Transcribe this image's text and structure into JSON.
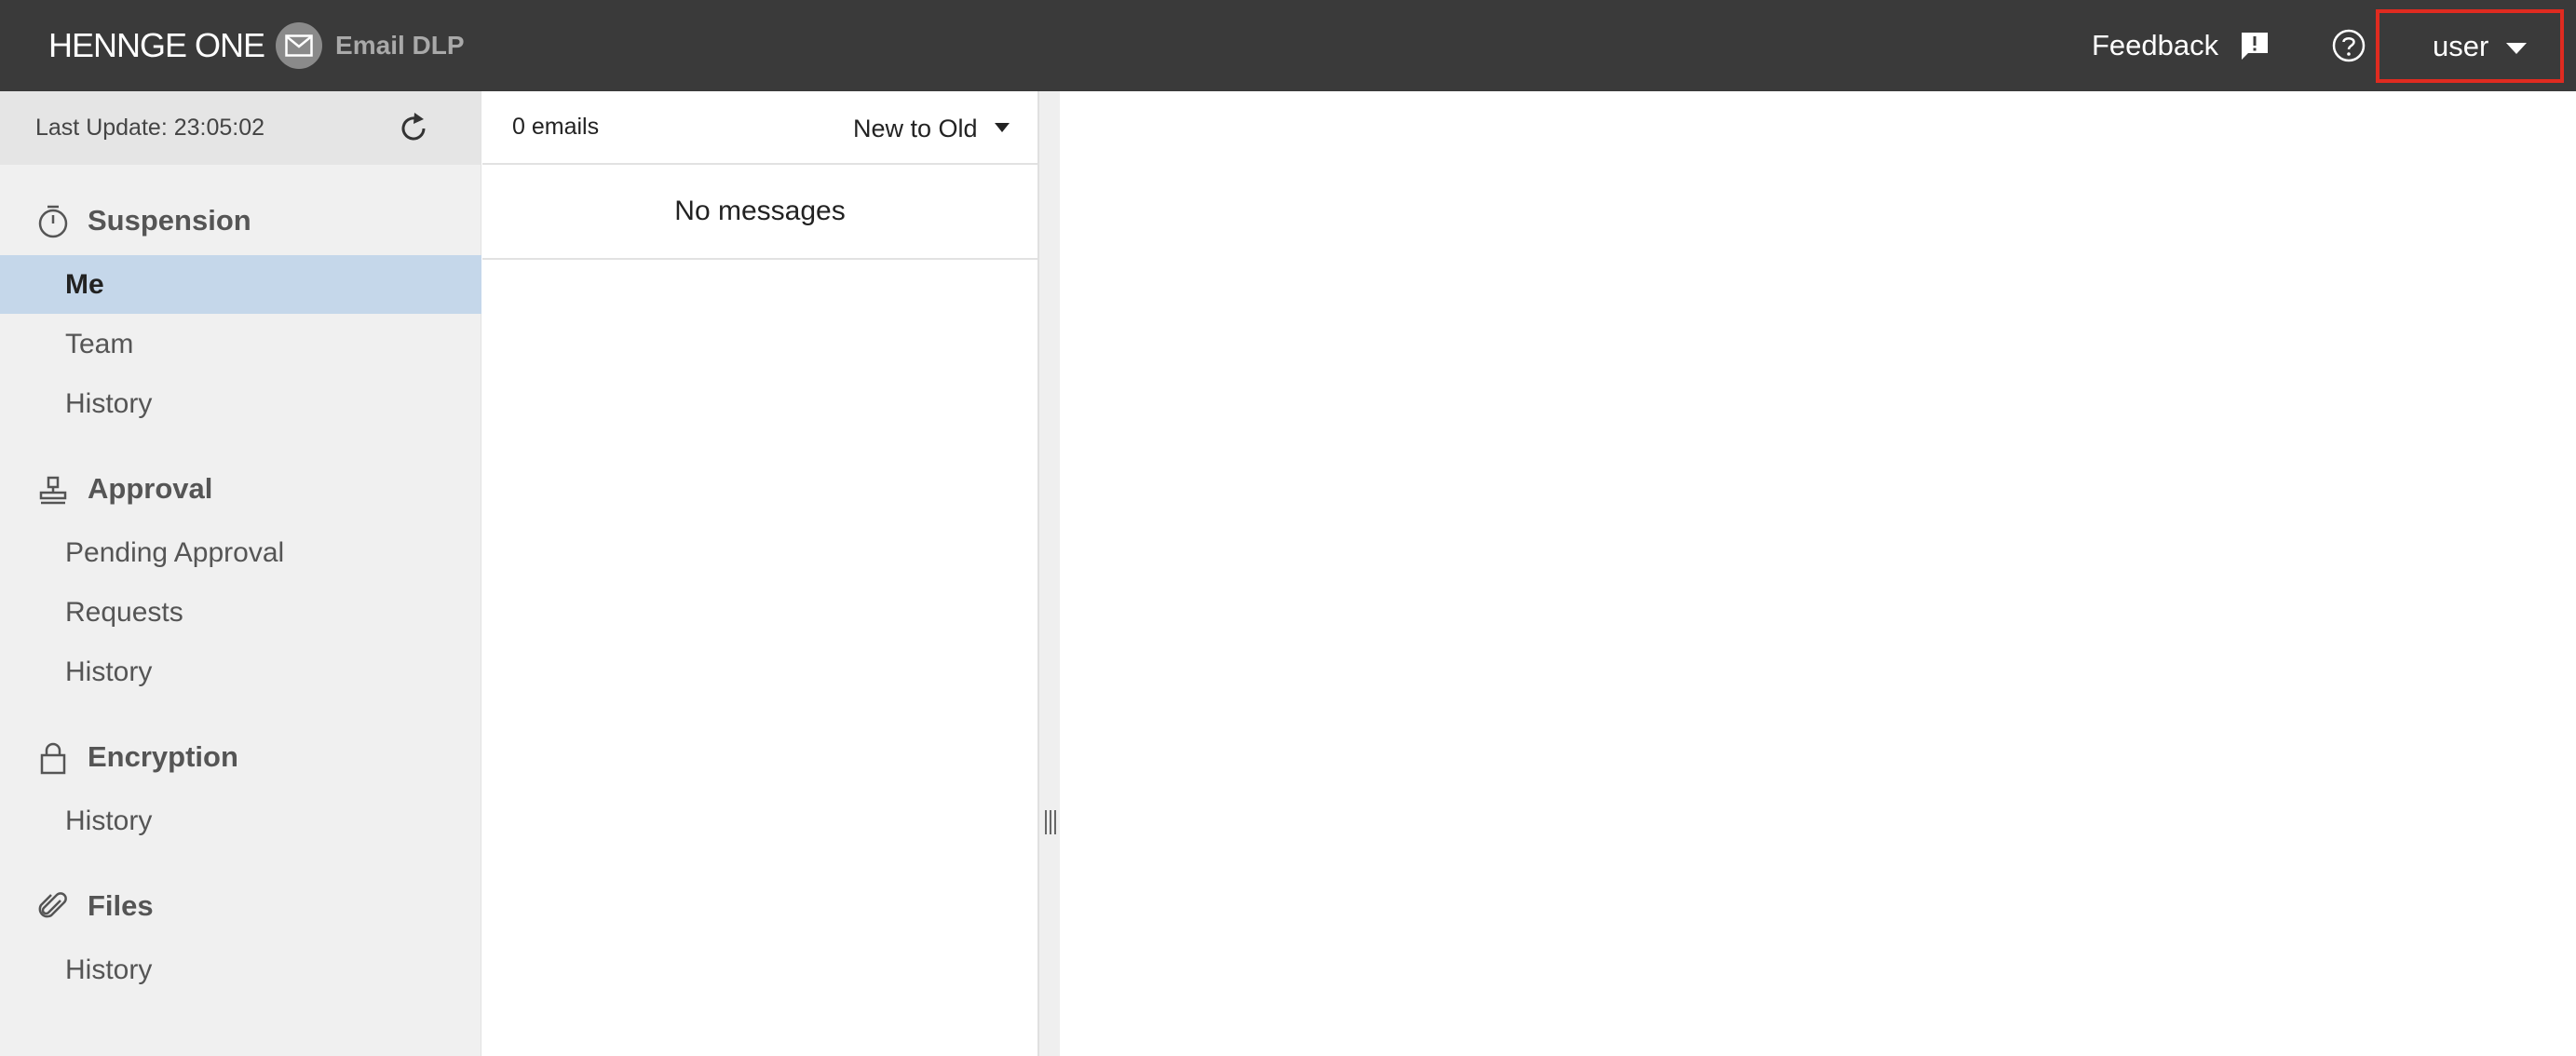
{
  "header": {
    "brand": "HENNGE One",
    "product": "Email DLP",
    "feedback_label": "Feedback",
    "feedback_icon": "feedback-icon",
    "help_icon": "help-icon",
    "user_label": "user",
    "user_caret_icon": "chevron-down-icon",
    "colors": {
      "bar": "#3a3a3a",
      "user_highlight": "#e02b20"
    }
  },
  "sidebar": {
    "last_update": "Last Update: 23:05:02",
    "refresh_icon": "refresh-icon",
    "sections": [
      {
        "label": "Suspension",
        "icon": "timer-icon",
        "items": [
          "Me",
          "Team",
          "History"
        ]
      },
      {
        "label": "Approval",
        "icon": "stamp-icon",
        "items": [
          "Pending Approval",
          "Requests",
          "History"
        ]
      },
      {
        "label": "Encryption",
        "icon": "lock-icon",
        "items": [
          "History"
        ]
      },
      {
        "label": "Files",
        "icon": "paperclip-icon",
        "items": [
          "History"
        ]
      }
    ],
    "active_item": "Me",
    "colors": {
      "active_bg": "#c5d7ea"
    }
  },
  "list": {
    "count": "0 emails",
    "sort_label": "New to Old",
    "empty_message": "No messages"
  }
}
